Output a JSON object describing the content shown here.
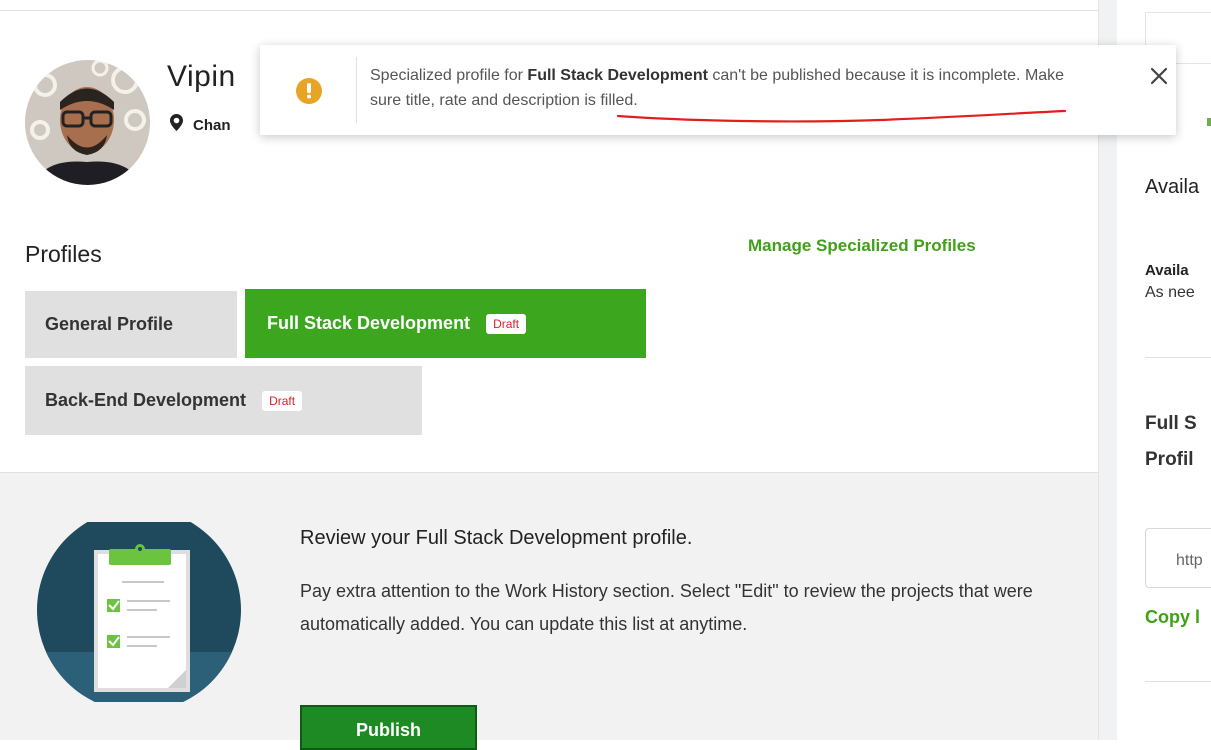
{
  "user": {
    "name": "Vipin",
    "location": "Chan"
  },
  "toast": {
    "prefix": "Specialized profile for ",
    "profile_name": "Full Stack Development",
    "middle": " can't be published because it is incomplete. ",
    "underlined": "Make sure title, rate and description is filled."
  },
  "profiles": {
    "title": "Profiles",
    "manage_link": "Manage Specialized Profiles",
    "tabs": [
      {
        "label": "General Profile"
      },
      {
        "label": "Full Stack Development",
        "badge": "Draft"
      },
      {
        "label": "Back-End Development",
        "badge": "Draft"
      }
    ]
  },
  "review": {
    "title": "Review your Full Stack Development profile.",
    "text": "Pay extra attention to the Work History section. Select \"Edit\" to review the projects that were automatically added. You can update this list at anytime.",
    "button": "Publish"
  },
  "right_panel": {
    "avail_heading": "Availa",
    "avail_label": "Availa",
    "avail_value": "As nee",
    "fs_line1": "Full S",
    "fs_line2": "Profil",
    "url_value": "http",
    "copy_link": "Copy l"
  },
  "colors": {
    "brand_green": "#3ca61f",
    "link_green": "#41a018",
    "publish_green": "#1d8a24",
    "warning": "#e8a426",
    "draft_red": "#d0262d"
  },
  "icons": [
    "warning-icon",
    "close-icon",
    "location-pin-icon",
    "clipboard-illustration"
  ]
}
